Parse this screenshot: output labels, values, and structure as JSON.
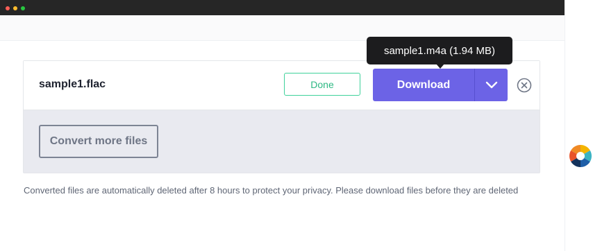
{
  "window": {
    "controls": [
      "close",
      "minimize",
      "maximize"
    ]
  },
  "file": {
    "name": "sample1.flac",
    "status": "Done"
  },
  "download": {
    "label": "Download",
    "toggle_icon": "chevron-down-icon",
    "tooltip": "sample1.m4a (1.94 MB)"
  },
  "actions": {
    "remove_icon": "close-circle-icon",
    "convert_more_label": "Convert more files"
  },
  "notice": {
    "text": "Converted files are automatically deleted after 8 hours to protect your privacy. Please download files before they are deleted"
  },
  "colors": {
    "accent": "#6c63e6",
    "success": "#3ed19a",
    "titlebar": "#262626"
  }
}
